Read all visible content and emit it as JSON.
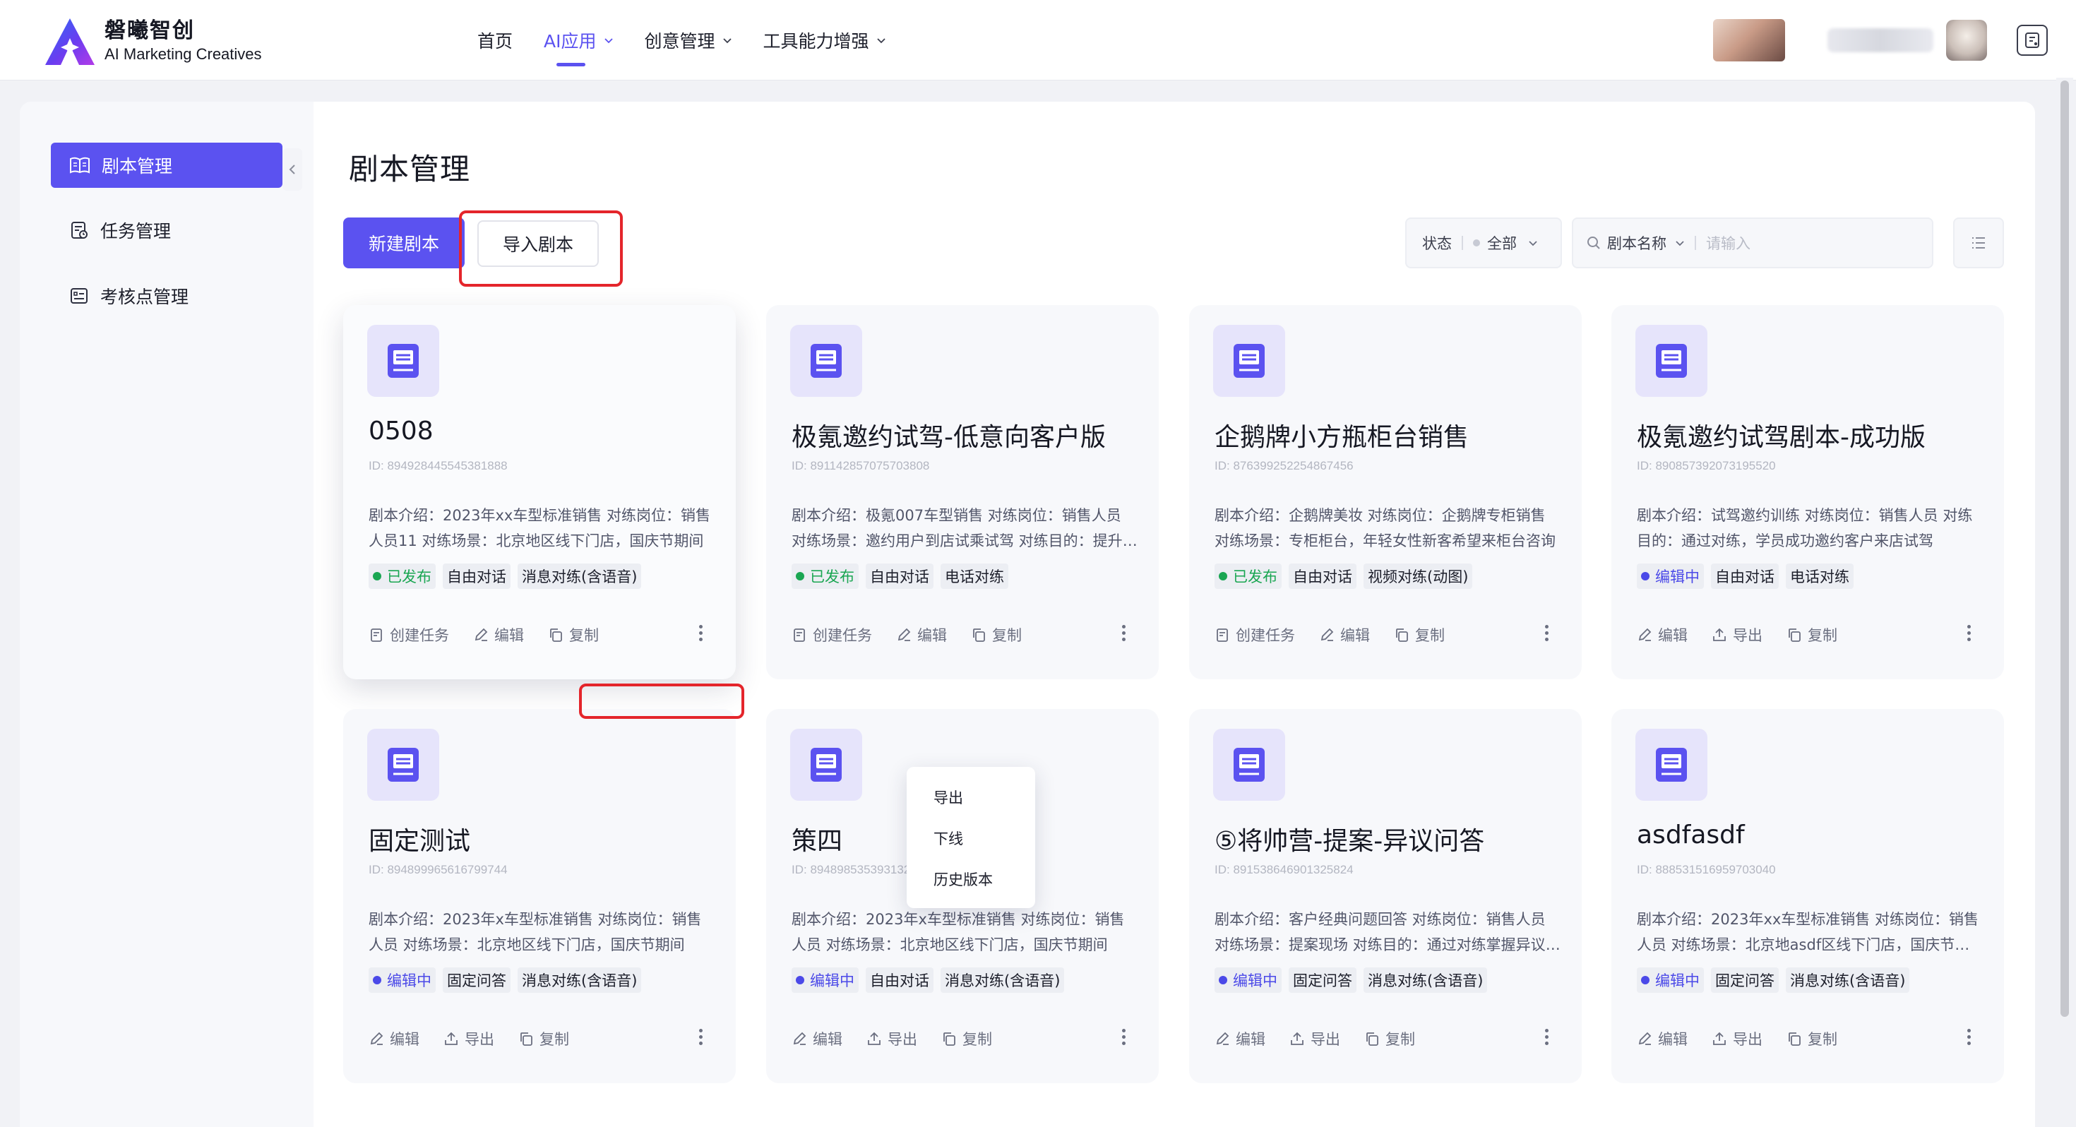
{
  "brand": {
    "name_cn": "磐曦智创",
    "name_en": "AI Marketing Creatives"
  },
  "nav": {
    "items": [
      {
        "label": "首页",
        "active": false,
        "has_dropdown": false
      },
      {
        "label": "AI应用",
        "active": true,
        "has_dropdown": true
      },
      {
        "label": "创意管理",
        "active": false,
        "has_dropdown": true
      },
      {
        "label": "工具能力增强",
        "active": false,
        "has_dropdown": true
      }
    ]
  },
  "sidebar": {
    "items": [
      {
        "label": "剧本管理",
        "icon": "book-icon",
        "active": true
      },
      {
        "label": "任务管理",
        "icon": "task-icon",
        "active": false
      },
      {
        "label": "考核点管理",
        "icon": "checklist-icon",
        "active": false
      }
    ]
  },
  "page": {
    "title": "剧本管理",
    "new_button": "新建剧本",
    "import_button": "导入剧本"
  },
  "filters": {
    "status_label": "状态",
    "status_value": "全部",
    "search_field": "剧本名称",
    "search_placeholder": "请输入"
  },
  "cards": [
    {
      "title": "0508",
      "id": "ID: 894928445545381888",
      "desc": "剧本介绍：2023年xx车型标准销售 对练岗位：销售人员11 对练场景：北京地区线下门店，国庆节期间",
      "status": "已发布",
      "status_type": "published",
      "tags": [
        "自由对话",
        "消息对练(含语音)"
      ],
      "actions": [
        "创建任务",
        "编辑",
        "复制"
      ]
    },
    {
      "title": "极氪邀约试驾-低意向客户版",
      "id": "ID: 891142857075703808",
      "desc": "剧本介绍：极氪007车型销售 对练岗位：销售人员 对练场景：邀约用户到店试乘试驾 对练目的：提升邀约成功率",
      "status": "已发布",
      "status_type": "published",
      "tags": [
        "自由对话",
        "电话对练"
      ],
      "actions": [
        "创建任务",
        "编辑",
        "复制"
      ]
    },
    {
      "title": "企鹅牌小方瓶柜台销售",
      "id": "ID: 876399252254867456",
      "desc": "剧本介绍：企鹅牌美妆 对练岗位：企鹅牌专柜销售 对练场景：专柜柜台，年轻女性新客希望来柜台咨询",
      "status": "已发布",
      "status_type": "published",
      "tags": [
        "自由对话",
        "视频对练(动图)"
      ],
      "actions": [
        "创建任务",
        "编辑",
        "复制"
      ]
    },
    {
      "title": "极氪邀约试驾剧本-成功版",
      "id": "ID: 890857392073195520",
      "desc": "剧本介绍：试驾邀约训练 对练岗位：销售人员 对练目的：通过对练，学员成功邀约客户来店试驾",
      "status": "编辑中",
      "status_type": "editing",
      "tags": [
        "自由对话",
        "电话对练"
      ],
      "actions": [
        "编辑",
        "导出",
        "复制"
      ]
    },
    {
      "title": "固定测试",
      "id": "ID: 894899965616799744",
      "desc": "剧本介绍：2023年x车型标准销售 对练岗位：销售人员 对练场景：北京地区线下门店，国庆节期间",
      "status": "编辑中",
      "status_type": "editing",
      "tags": [
        "固定问答",
        "消息对练(含语音)"
      ],
      "actions": [
        "编辑",
        "导出",
        "复制"
      ]
    },
    {
      "title": "策四",
      "id": "ID: 894898535393132544",
      "desc": "剧本介绍：2023年x车型标准销售 对练岗位：销售人员 对练场景：北京地区线下门店，国庆节期间",
      "status": "编辑中",
      "status_type": "editing",
      "tags": [
        "自由对话",
        "消息对练(含语音)"
      ],
      "actions": [
        "编辑",
        "导出",
        "复制"
      ]
    },
    {
      "title": "⑤将帅营-提案-异议问答",
      "id": "ID: 891538646901325824",
      "desc": "剧本介绍：客户经典问题回答 对练岗位：销售人员 对练场景：提案现场 对练目的：通过对练掌握异议处理",
      "status": "编辑中",
      "status_type": "editing",
      "tags": [
        "固定问答",
        "消息对练(含语音)"
      ],
      "actions": [
        "编辑",
        "导出",
        "复制"
      ]
    },
    {
      "title": "asdfasdf",
      "id": "ID: 888531516959703040",
      "desc": "剧本介绍：2023年xx车型标准销售 对练岗位：销售人员 对练场景：北京地asdf区线下门店，国庆节期间",
      "status": "编辑中",
      "status_type": "editing",
      "tags": [
        "固定问答",
        "消息对练(含语音)"
      ],
      "actions": [
        "编辑",
        "导出",
        "复制"
      ]
    }
  ],
  "dropdown": {
    "items": [
      "导出",
      "下线",
      "历史版本"
    ]
  },
  "colors": {
    "accent": "#5b52f0",
    "published": "#1aa652",
    "editing": "#4b49e8",
    "highlight": "#e4252b"
  }
}
